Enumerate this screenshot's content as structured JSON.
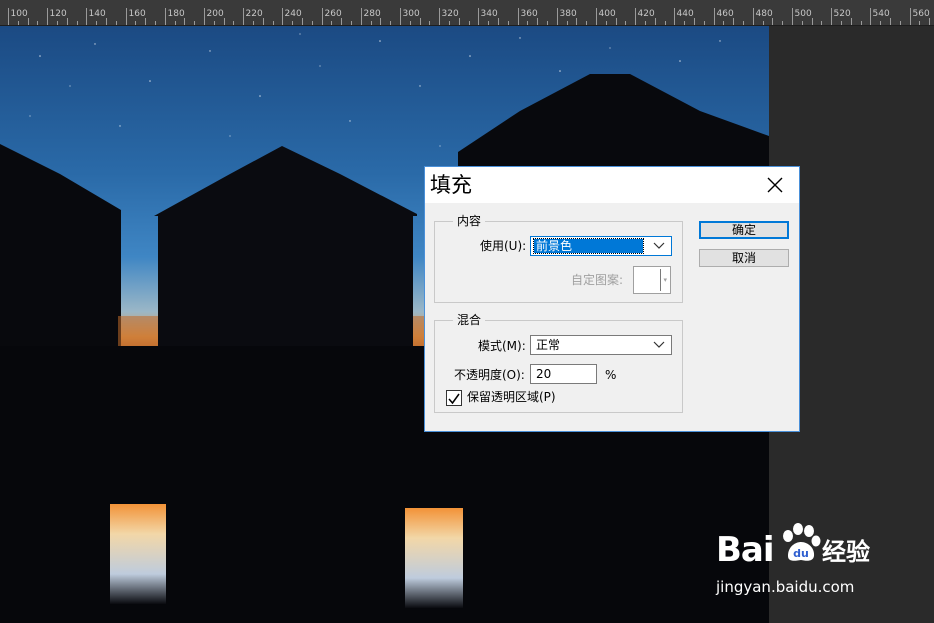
{
  "ruler": {
    "labels": [
      "100",
      "120",
      "140",
      "160",
      "180",
      "200",
      "220",
      "240",
      "260",
      "280",
      "300",
      "320",
      "340",
      "360",
      "380",
      "400",
      "420",
      "440",
      "460",
      "480",
      "500",
      "520",
      "540",
      "560"
    ]
  },
  "dialog": {
    "title": "填充",
    "content_group": {
      "label": "内容",
      "use_label": "使用(U):",
      "use_value": "前景色",
      "custom_pattern_label": "自定图案:"
    },
    "blend_group": {
      "label": "混合",
      "mode_label": "模式(M):",
      "mode_value": "正常",
      "opacity_label": "不透明度(O):",
      "opacity_value": "20",
      "opacity_unit": "%",
      "preserve_label": "保留透明区域(P)",
      "preserve_checked": true
    },
    "ok_label": "确定",
    "cancel_label": "取消"
  },
  "watermark": {
    "brand_left": "Bai",
    "brand_right": "经验",
    "url": "jingyan.baidu.com"
  },
  "colors": {
    "accent": "#0078d7",
    "dialog_border": "#4a90d9",
    "sky_top": "#1e4d86",
    "horizon_glow": "#e88a3a"
  }
}
